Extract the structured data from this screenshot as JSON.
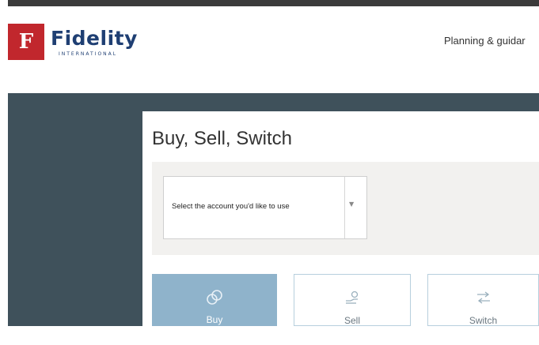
{
  "brand": {
    "mark": "F",
    "wordmark": "Fidelity",
    "sub": "INTERNATIONAL"
  },
  "nav": {
    "planning": "Planning & guidar"
  },
  "page": {
    "title": "Buy, Sell, Switch"
  },
  "account_select": {
    "value": "Select the account you'd like to use",
    "arrow_icon": "chevron-down-icon"
  },
  "actions": [
    {
      "label": "Buy",
      "icon": "coins-icon"
    },
    {
      "label": "Sell",
      "icon": "hand-coin-icon"
    },
    {
      "label": "Switch",
      "icon": "swap-arrows-icon"
    }
  ],
  "colors": {
    "brand_red": "#c1272d",
    "brand_blue": "#1f3f73",
    "slate": "#3f515b",
    "active_button": "#8fb3cb"
  }
}
